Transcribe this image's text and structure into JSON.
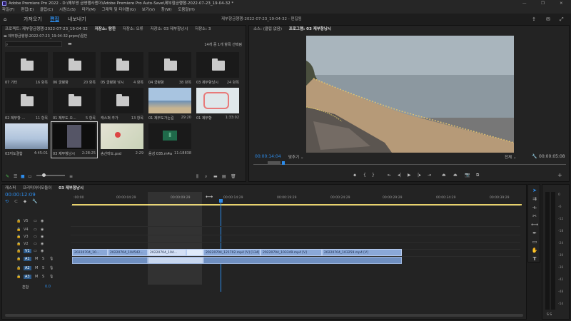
{
  "titlebar": {
    "title": "Adobe Premiere Pro 2022 - D:\\해부영 금영행사젠더\\Adobe Premiere Pro Auto-Save\\제부항금행행-2022-07-23_19-04-32 *"
  },
  "menu": [
    "파일(F)",
    "편집(E)",
    "클립(C)",
    "시퀀스(S)",
    "마커(M)",
    "그래픽 및 타이틀(G)",
    "보기(V)",
    "창(W)",
    "도움말(H)"
  ],
  "workspace": {
    "home": "홈",
    "assembly": "가져오기",
    "edit": "편집",
    "export": "내보내기",
    "center_title": "제부항금행행-2022-07-23_19-04-32 - 편집됨"
  },
  "project_panel": {
    "tabs": [
      "프로젝트: 제부항금행행-2022-07-23_19-04-32",
      "저장소: 탐한",
      "저장소: 오류",
      "저장소: 03 제부항낭시",
      "저장소: 3"
    ],
    "path": "제부항금행행-2022-07-23_19-04-32.prproj\\절반",
    "selection_status": "14개 중 1개 항목 선택됨",
    "items": [
      {
        "name": "07 기타",
        "count": "16 항목",
        "kind": "folder"
      },
      {
        "name": "06 궁평항",
        "count": "20 항목",
        "kind": "folder"
      },
      {
        "name": "05 궁평항 낚시",
        "count": "4 항목",
        "kind": "folder"
      },
      {
        "name": "04 궁평항",
        "count": "38 항목",
        "kind": "folder"
      },
      {
        "name": "03 제부항낭시",
        "count": "24 항목",
        "kind": "folder"
      },
      {
        "name": "02 제부항 ...",
        "count": "11 항목",
        "kind": "folder"
      },
      {
        "name": "01 제부도 오...",
        "count": "5 항목",
        "kind": "folder"
      },
      {
        "name": "캐스퍼 추가",
        "count": "13 항목",
        "kind": "folder"
      },
      {
        "name": "01 제부도가는길",
        "count": "29:20",
        "kind": "beach"
      },
      {
        "name": "01 제부항",
        "count": "1:33:02",
        "kind": "map"
      },
      {
        "name": "03지도결합",
        "count": "4:45:01",
        "kind": "pier"
      },
      {
        "name": "03 제부항낭시",
        "count": "2:28:25",
        "kind": "dark"
      },
      {
        "name": "송산마도.psd",
        "count": "2:29",
        "kind": "mapsat"
      },
      {
        "name": "음성 035.m4a",
        "count": "11:18838",
        "kind": "audio"
      }
    ]
  },
  "program_panel": {
    "tabs": [
      "소스: (클립 없음)",
      "프로그램: 03 제부항낭시"
    ],
    "timecode_current": "00:00:14:04",
    "fit": "맞추기",
    "quality": "전체",
    "timecode_total": "00:00:05:08"
  },
  "timeline": {
    "tabs": [
      "캐스퍼",
      "프리미어어모듈이",
      "03 제부항낭시"
    ],
    "timecode": "00:00:12:09",
    "ruler": [
      ":00:00",
      "00:00:04:29",
      "00:00:09:29",
      "00:00:14:29",
      "00:00:19:29",
      "00:00:24:29",
      "00:00:29:29",
      "00:00:34:29",
      "00:00:39:29"
    ],
    "video_tracks": [
      "V5",
      "V4",
      "V3",
      "V2",
      "V1"
    ],
    "audio_tracks": [
      "A1",
      "A2",
      "A3"
    ],
    "mix_label": "혼합",
    "mix_value": "0.0",
    "clips": [
      "20220704_10...",
      "20220704_104542...",
      "20220704_104...",
      "20220704_121702.mp4 [V] [134]",
      "20220704_103349.mp4 [V]",
      "20220704_103259.mp4 [V]"
    ]
  },
  "meter": {
    "scale": [
      "0",
      "-6",
      "-12",
      "-18",
      "-24",
      "-30",
      "-36",
      "-42",
      "-48",
      "-54"
    ],
    "bottom": "S S"
  },
  "colors": {
    "accent": "#2d8ceb",
    "clip": "#8aa8d8",
    "playhead": "#2d8ceb",
    "workarea": "#e8d26a"
  }
}
